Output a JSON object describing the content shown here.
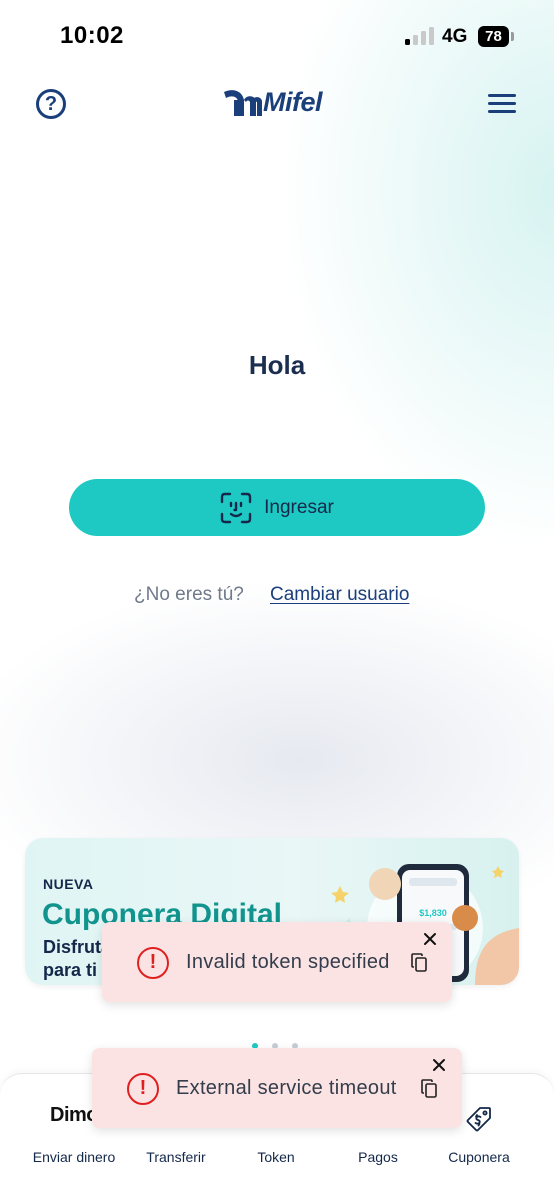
{
  "status_bar": {
    "time": "10:02",
    "network": "4G",
    "battery": "78"
  },
  "header": {
    "help_glyph": "?",
    "brand": "Mifel"
  },
  "main": {
    "greeting": "Hola",
    "login_button": "Ingresar",
    "not_you": "¿No eres tú?",
    "change_user": "Cambiar usuario"
  },
  "promo": {
    "badge": "NUEVA",
    "title": "Cuponera Digital",
    "subtitle_line1": "Disfruta",
    "subtitle_line2": "para ti",
    "phone_amount": "$1,830"
  },
  "carousel": {
    "pages": 3,
    "active": 0
  },
  "bottom_nav": {
    "items": [
      {
        "label": "Enviar dinero",
        "icon": "dimo-icon",
        "icon_text": "Dimo"
      },
      {
        "label": "Transferir",
        "icon": "transfer-icon"
      },
      {
        "label": "Token",
        "icon": "token-icon"
      },
      {
        "label": "Pagos",
        "icon": "payments-icon"
      },
      {
        "label": "Cuponera",
        "icon": "coupon-tag-icon"
      }
    ]
  },
  "toasts": [
    {
      "message": "Invalid token specified",
      "error_glyph": "!"
    },
    {
      "message": "External service timeout",
      "error_glyph": "!"
    }
  ],
  "colors": {
    "brand_navy": "#1b3f7a",
    "accent_teal": "#1ec9c4",
    "error_red": "#e02020",
    "toast_bg": "#fbe3e4"
  }
}
